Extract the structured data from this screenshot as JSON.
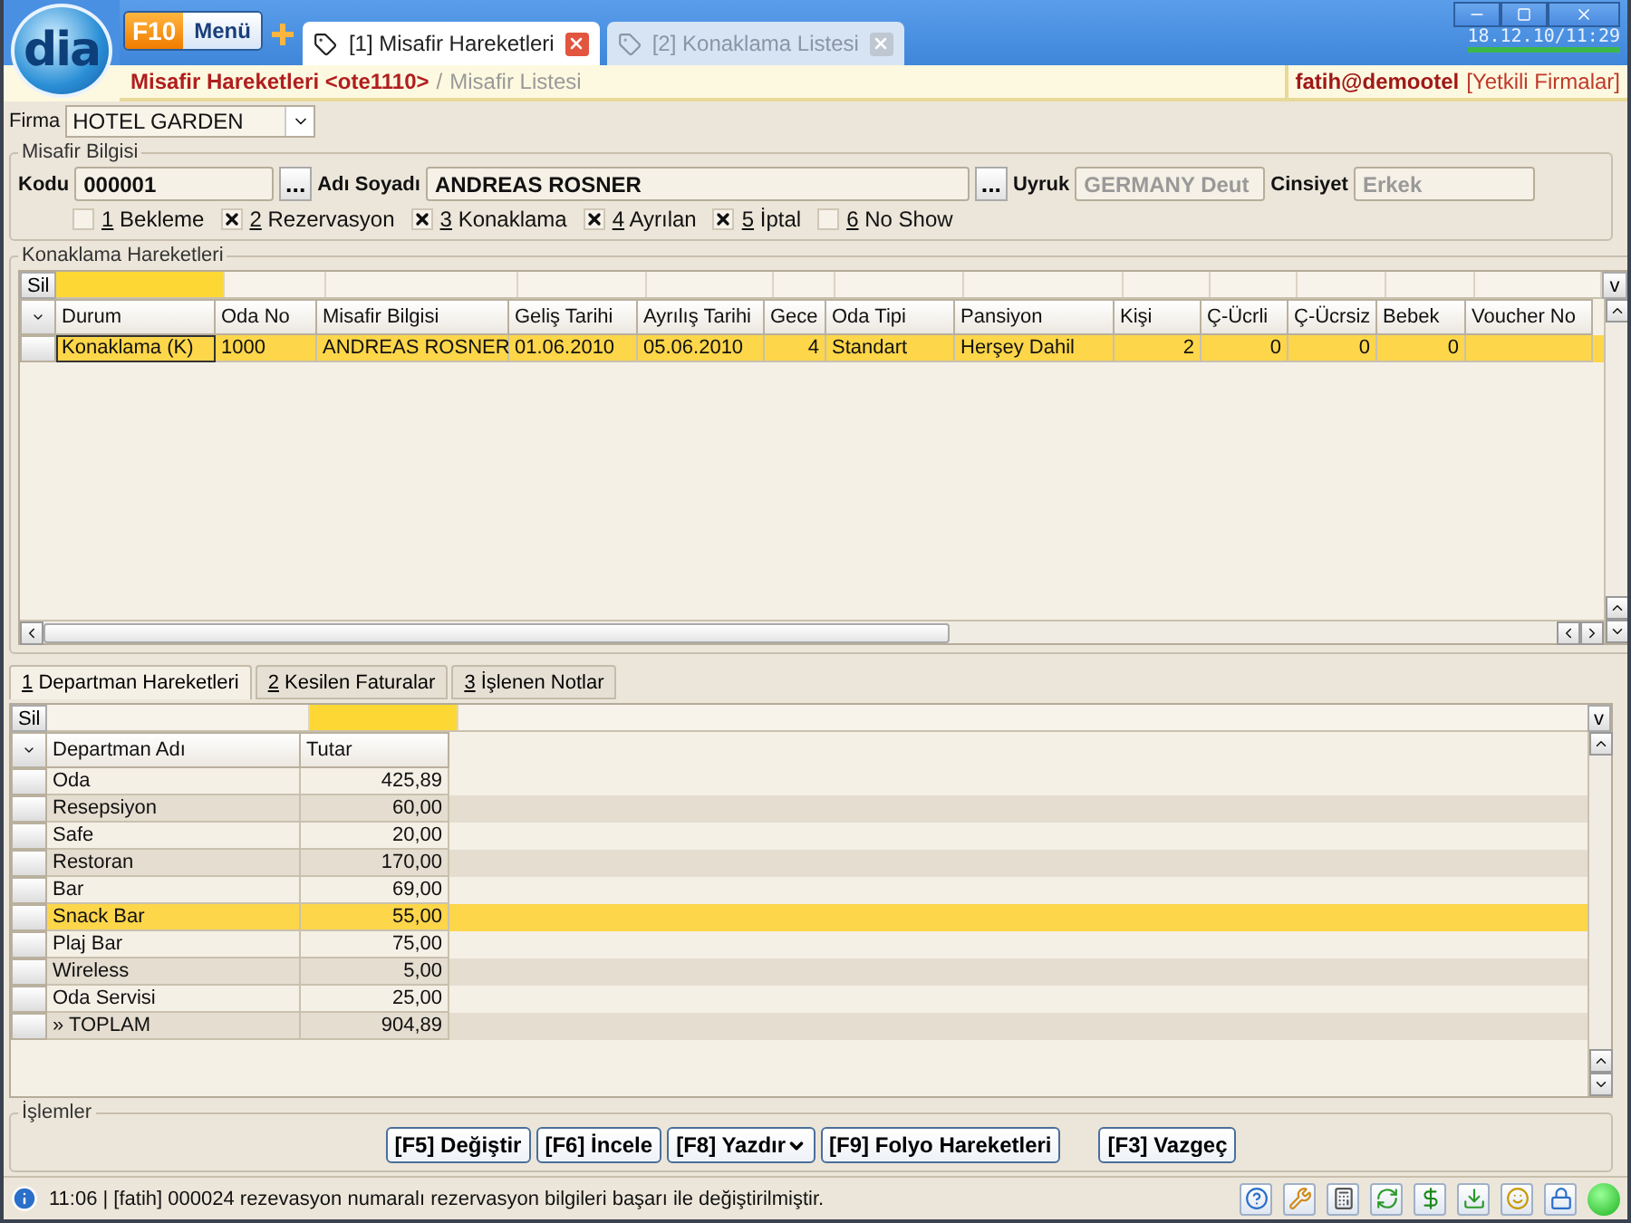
{
  "app": {
    "logo": "dia",
    "f10": "F10",
    "menu": "Menü"
  },
  "tabs": [
    {
      "label": "[1] Misafir Hareketleri",
      "selected": true
    },
    {
      "label": "[2] Konaklama Listesi",
      "selected": false
    }
  ],
  "clock": "18.12.10/11:29",
  "breadcrumb": {
    "title": "Misafir Hareketleri <ote1110>",
    "separator": "/",
    "sub": "Misafir Listesi"
  },
  "user": {
    "name": "fatih@demootel",
    "link": "[Yetkili Firmalar]"
  },
  "firma": {
    "label": "Firma",
    "value": "HOTEL GARDEN"
  },
  "guest": {
    "title": "Misafir Bilgisi",
    "fields": [
      {
        "label": "Kodu",
        "value": "000001",
        "lookup": "...",
        "disabled": false
      },
      {
        "label": "Adı Soyadı",
        "value": "ANDREAS ROSNER",
        "lookup": "...",
        "disabled": false
      },
      {
        "label": "Uyruk",
        "value": "GERMANY Deut",
        "disabled": true
      },
      {
        "label": "Cinsiyet",
        "value": "Erkek",
        "disabled": true
      }
    ]
  },
  "status_filters": [
    {
      "key": "1",
      "label": "Bekleme",
      "checked": false
    },
    {
      "key": "2",
      "label": "Rezervasyon",
      "checked": true
    },
    {
      "key": "3",
      "label": "Konaklama",
      "checked": true
    },
    {
      "key": "4",
      "label": "Ayrılan",
      "checked": true
    },
    {
      "key": "5",
      "label": "İptal",
      "checked": true
    },
    {
      "key": "6",
      "label": "No Show",
      "checked": false
    }
  ],
  "stays": {
    "title": "Konaklama Hareketleri",
    "delete": "Sil",
    "menu": "v",
    "columns": [
      {
        "label": "Durum",
        "kind": "text"
      },
      {
        "label": "Oda No",
        "kind": "text"
      },
      {
        "label": "Misafir Bilgisi",
        "kind": "text"
      },
      {
        "label": "Geliş Tarihi",
        "kind": "text"
      },
      {
        "label": "Ayrılış Tarihi",
        "kind": "text"
      },
      {
        "label": "Gece",
        "kind": "number"
      },
      {
        "label": "Oda Tipi",
        "kind": "text"
      },
      {
        "label": "Pansiyon",
        "kind": "text"
      },
      {
        "label": "Kişi",
        "kind": "number"
      },
      {
        "label": "Ç-Ücrli",
        "kind": "number"
      },
      {
        "label": "Ç-Ücrsiz",
        "kind": "number"
      },
      {
        "label": "Bebek",
        "kind": "number"
      },
      {
        "label": "Voucher No",
        "kind": "text"
      }
    ],
    "rows": [
      {
        "selected": true,
        "cells": [
          "Konaklama (K)",
          "1000",
          "ANDREAS ROSNER",
          "01.06.2010",
          "05.06.2010",
          "4",
          "Standart",
          "Herşey Dahil",
          "2",
          "0",
          "0",
          "0",
          null
        ]
      }
    ]
  },
  "detail_tabs": [
    {
      "key": "1",
      "label": "Departman Hareketleri",
      "selected": true
    },
    {
      "key": "2",
      "label": "Kesilen Faturalar",
      "selected": false
    },
    {
      "key": "3",
      "label": "İşlenen Notlar",
      "selected": false
    }
  ],
  "departments": {
    "delete": "Sil",
    "menu": "v",
    "columns": [
      "Departman Adı",
      "Tutar"
    ],
    "rows": [
      {
        "name": "Oda",
        "amount": "425,89",
        "selected": false
      },
      {
        "name": "Resepsiyon",
        "amount": "60,00",
        "selected": false
      },
      {
        "name": "Safe",
        "amount": "20,00",
        "selected": false
      },
      {
        "name": "Restoran",
        "amount": "170,00",
        "selected": false
      },
      {
        "name": "Bar",
        "amount": "69,00",
        "selected": false
      },
      {
        "name": "Snack Bar",
        "amount": "55,00",
        "selected": true
      },
      {
        "name": "Plaj Bar",
        "amount": "75,00",
        "selected": false
      },
      {
        "name": "Wireless",
        "amount": "5,00",
        "selected": false
      },
      {
        "name": "Oda Servisi",
        "amount": "25,00",
        "selected": false
      },
      {
        "name": "» TOPLAM",
        "amount": "904,89",
        "selected": false
      }
    ]
  },
  "actions": {
    "title": "İşlemler",
    "buttons": [
      {
        "label": "[F5] Değiştir",
        "menu": false
      },
      {
        "label": "[F6] İncele",
        "menu": false
      },
      {
        "label": "[F8] Yazdır",
        "menu": true
      },
      {
        "label": "[F9] Folyo Hareketleri",
        "menu": false
      }
    ],
    "cancel": "[F3] Vazgeç"
  },
  "status_bar": {
    "message": "11:06 | [fatih] 000024 rezevasyon numaralı rezervasyon bilgileri başarı ile değiştirilmiştir."
  }
}
